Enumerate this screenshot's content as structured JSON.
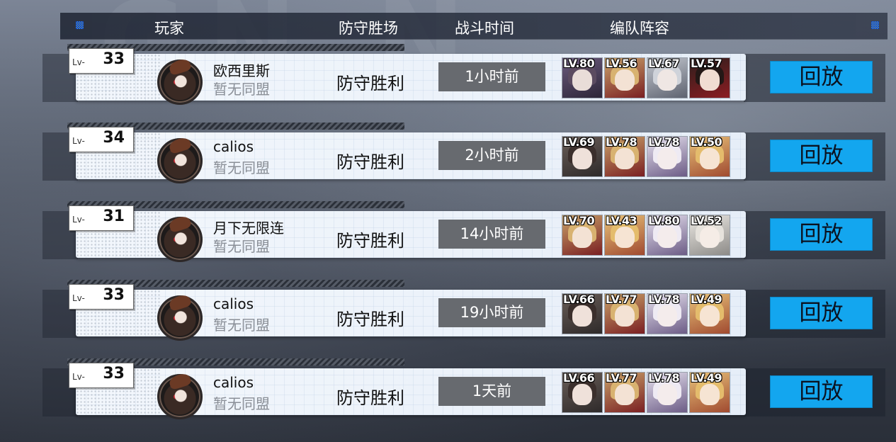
{
  "header": {
    "player": "玩家",
    "defense_result": "防守胜场",
    "battle_time": "战斗时间",
    "lineup": "编队阵容"
  },
  "level_prefix": "Lv-",
  "replay_label": "回放",
  "records": [
    {
      "level": "33",
      "name": "欧西里斯",
      "alliance": "暂无同盟",
      "result": "防守胜利",
      "time": "1小时前",
      "team": [
        {
          "lv": "LV.80",
          "skin": "dark-purple"
        },
        {
          "lv": "LV.56",
          "skin": "red-blonde"
        },
        {
          "lv": "LV.67",
          "skin": "silver"
        },
        {
          "lv": "LV.57",
          "skin": "black-red"
        }
      ]
    },
    {
      "level": "34",
      "name": "calios",
      "alliance": "暂无同盟",
      "result": "防守胜利",
      "time": "2小时前",
      "team": [
        {
          "lv": "LV.69",
          "skin": "dark-grey"
        },
        {
          "lv": "LV.78",
          "skin": "red-blonde"
        },
        {
          "lv": "LV.78",
          "skin": "white-purple"
        },
        {
          "lv": "LV.50",
          "skin": "blonde-blue"
        }
      ]
    },
    {
      "level": "31",
      "name": "月下无限连",
      "alliance": "暂无同盟",
      "result": "防守胜利",
      "time": "14小时前",
      "team": [
        {
          "lv": "LV.70",
          "skin": "red-blonde"
        },
        {
          "lv": "LV.43",
          "skin": "blonde-blue"
        },
        {
          "lv": "LV.80",
          "skin": "white-purple"
        },
        {
          "lv": "LV.52",
          "skin": "white-grey"
        }
      ]
    },
    {
      "level": "33",
      "name": "calios",
      "alliance": "暂无同盟",
      "result": "防守胜利",
      "time": "19小时前",
      "team": [
        {
          "lv": "LV.66",
          "skin": "dark-grey"
        },
        {
          "lv": "LV.77",
          "skin": "red-blonde"
        },
        {
          "lv": "LV.78",
          "skin": "white-purple"
        },
        {
          "lv": "LV.49",
          "skin": "blonde-blue"
        }
      ]
    },
    {
      "level": "33",
      "name": "calios",
      "alliance": "暂无同盟",
      "result": "防守胜利",
      "time": "1天前",
      "team": [
        {
          "lv": "LV.66",
          "skin": "dark-grey"
        },
        {
          "lv": "LV.77",
          "skin": "red-blonde"
        },
        {
          "lv": "LV.78",
          "skin": "white-purple"
        },
        {
          "lv": "LV.49",
          "skin": "blonde-blue"
        }
      ]
    }
  ],
  "colors": {
    "replay_button": "#13a6ef",
    "time_badge": "#676a6f"
  }
}
